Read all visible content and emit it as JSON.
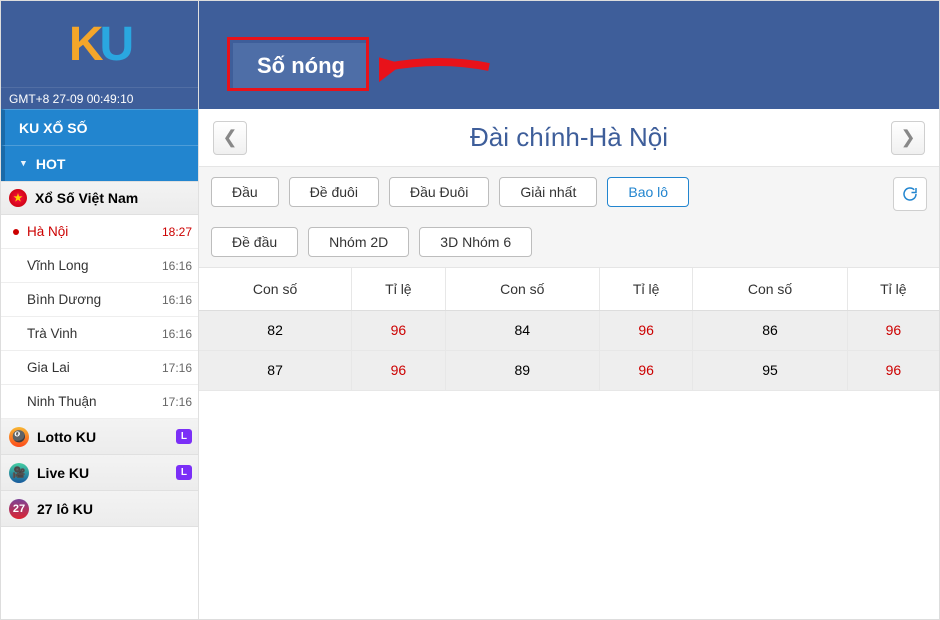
{
  "logo": {
    "k": "K",
    "u": "U"
  },
  "clock": "GMT+8 27-09 00:49:10",
  "sidebar": {
    "section1": "KU XỔ SỐ",
    "section2": "HOT",
    "vn_head": "Xổ Số Việt Nam",
    "lotteries": [
      {
        "name": "Hà Nội",
        "time": "18:27",
        "active": true
      },
      {
        "name": "Vĩnh Long",
        "time": "16:16",
        "active": false
      },
      {
        "name": "Bình Dương",
        "time": "16:16",
        "active": false
      },
      {
        "name": "Trà Vinh",
        "time": "16:16",
        "active": false
      },
      {
        "name": "Gia Lai",
        "time": "17:16",
        "active": false
      },
      {
        "name": "Ninh Thuận",
        "time": "17:16",
        "active": false
      }
    ],
    "cats": [
      {
        "name": "Lotto KU",
        "badge": "L"
      },
      {
        "name": "Live KU",
        "badge": "L"
      },
      {
        "name": "27 lô KU",
        "badge": ""
      }
    ]
  },
  "top_tab": "Số nóng",
  "page_title": "Đài chính-Hà Nội",
  "filters": {
    "row1": [
      "Đầu",
      "Đề đuôi",
      "Đầu Đuôi",
      "Giải nhất",
      "Bao lô"
    ],
    "row2": [
      "Đề đầu",
      "Nhóm 2D",
      "3D Nhóm 6"
    ],
    "active": "Bao lô"
  },
  "table": {
    "headers": [
      "Con số",
      "Tỉ lệ",
      "Con số",
      "Tỉ lệ",
      "Con số",
      "Tỉ lệ"
    ],
    "rows": [
      [
        "82",
        "96",
        "84",
        "96",
        "86",
        "96"
      ],
      [
        "87",
        "96",
        "89",
        "96",
        "95",
        "96"
      ]
    ]
  }
}
